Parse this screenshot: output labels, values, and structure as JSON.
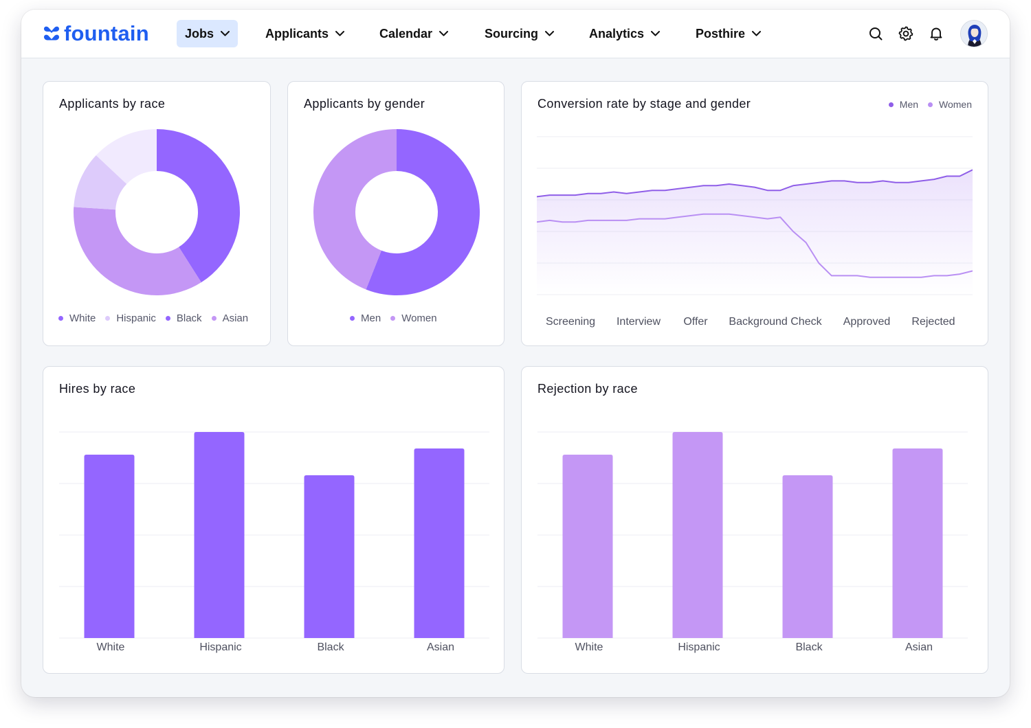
{
  "app": {
    "brand": "fountain",
    "brand_color": "#1f5ef0"
  },
  "nav": {
    "items": [
      {
        "label": "Jobs",
        "active": true
      },
      {
        "label": "Applicants"
      },
      {
        "label": "Calendar"
      },
      {
        "label": "Sourcing"
      },
      {
        "label": "Analytics"
      },
      {
        "label": "Posthire"
      }
    ],
    "icons": [
      "search-icon",
      "gear-icon",
      "bell-icon",
      "avatar"
    ]
  },
  "colors": {
    "purple_dark": "#9466ff",
    "purple_mid": "#c497f5",
    "purple_light": "#ddcbfb",
    "purple_pale": "#f1eafe",
    "line_men": "#8f5ee8",
    "line_women": "#b98ff3"
  },
  "cards": {
    "race": {
      "title": "Applicants by race"
    },
    "gender": {
      "title": "Applicants by gender"
    },
    "conversion": {
      "title": "Conversion rate by stage and gender"
    },
    "hires": {
      "title": "Hires by race"
    },
    "rejection": {
      "title": "Rejection by race"
    }
  },
  "chart_data": [
    {
      "id": "applicants-by-race",
      "type": "pie",
      "title": "Applicants by race",
      "labels": [
        "White",
        "Hispanic",
        "Black",
        "Asian"
      ],
      "values": [
        41,
        35,
        11,
        13
      ],
      "colors": [
        "#9466ff",
        "#c497f5",
        "#ddcbfb",
        "#f1eafe"
      ],
      "legend": [
        "White",
        "Hispanic",
        "Black",
        "Asian"
      ],
      "legend_colors": [
        "#9466ff",
        "#ddcbfb",
        "#9466ff",
        "#c497f5"
      ],
      "legend_position": "bottom"
    },
    {
      "id": "applicants-by-gender",
      "type": "pie",
      "title": "Applicants by gender",
      "labels": [
        "Men",
        "Women"
      ],
      "values": [
        56,
        44
      ],
      "colors": [
        "#9466ff",
        "#c497f5"
      ],
      "legend": [
        "Men",
        "Women"
      ],
      "legend_colors": [
        "#9466ff",
        "#c497f5"
      ],
      "legend_position": "bottom"
    },
    {
      "id": "conversion-by-stage-gender",
      "type": "line",
      "title": "Conversion rate by stage and gender",
      "categories": [
        "Screening",
        "Interview",
        "Offer",
        "Background Check",
        "Approved",
        "Rejected"
      ],
      "legend_position": "top-right",
      "grid": true,
      "ylim": [
        0,
        100
      ],
      "series": [
        {
          "name": "Men",
          "color": "#8f5ee8",
          "values": [
            62,
            63,
            63,
            63,
            64,
            64,
            65,
            64,
            65,
            66,
            66,
            67,
            68,
            69,
            69,
            70,
            69,
            68,
            66,
            66,
            69,
            70,
            71,
            72,
            72,
            71,
            71,
            72,
            71,
            71,
            72,
            73,
            75,
            75,
            79
          ]
        },
        {
          "name": "Women",
          "color": "#b98ff3",
          "values": [
            46,
            47,
            46,
            46,
            47,
            47,
            47,
            47,
            48,
            48,
            48,
            49,
            50,
            51,
            51,
            51,
            50,
            49,
            48,
            49,
            40,
            33,
            20,
            12,
            12,
            12,
            11,
            11,
            11,
            11,
            11,
            12,
            12,
            13,
            15
          ]
        }
      ]
    },
    {
      "id": "hires-by-race",
      "type": "bar",
      "title": "Hires by race",
      "categories": [
        "White",
        "Hispanic",
        "Black",
        "Asian"
      ],
      "values": [
        89,
        100,
        79,
        92
      ],
      "ylim": [
        0,
        100
      ],
      "grid": true,
      "color": "#9466ff"
    },
    {
      "id": "rejection-by-race",
      "type": "bar",
      "title": "Rejection by race",
      "categories": [
        "White",
        "Hispanic",
        "Black",
        "Asian"
      ],
      "values": [
        89,
        100,
        79,
        92
      ],
      "ylim": [
        0,
        100
      ],
      "grid": true,
      "color": "#c497f5"
    }
  ]
}
